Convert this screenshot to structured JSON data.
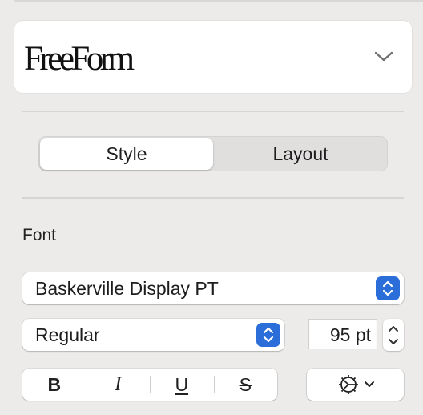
{
  "style_preview": {
    "text": "FreeForm",
    "chevron_icon": "chevron-down-icon"
  },
  "tabs": [
    {
      "label": "Style",
      "active": true
    },
    {
      "label": "Layout",
      "active": false
    }
  ],
  "font_section": {
    "label": "Font",
    "family": "Baskerville Display PT",
    "typeface": "Regular",
    "size": "95 pt"
  },
  "format_buttons": {
    "bold": "B",
    "italic": "I",
    "underline": "U",
    "strikethrough": "S"
  },
  "advanced_options": {
    "icon": "gear-icon"
  },
  "colors": {
    "accent": "#2b6ed9",
    "background": "#ecebea"
  }
}
